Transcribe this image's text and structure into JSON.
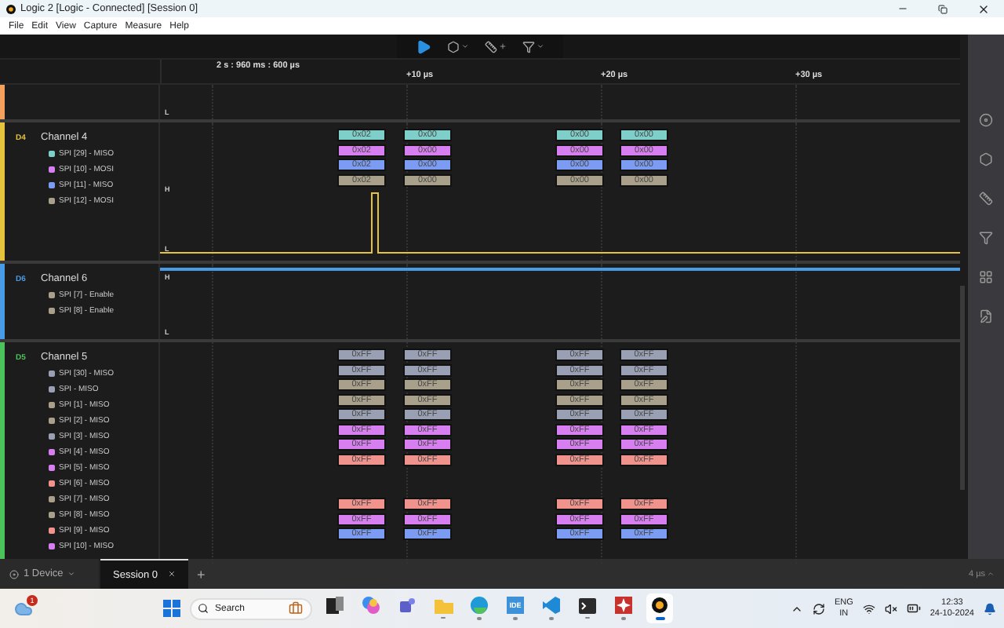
{
  "window": {
    "title": "Logic 2 [Logic - Connected] [Session 0]"
  },
  "menu": [
    "File",
    "Edit",
    "View",
    "Capture",
    "Measure",
    "Help"
  ],
  "timeline": {
    "origin": "2 s : 960 ms : 600 µs",
    "ticks": [
      "+10 µs",
      "+20 µs",
      "+30 µs"
    ]
  },
  "channels": [
    {
      "kind": "partial",
      "color": "#f4a15d",
      "markers": [
        {
          "text": "L",
          "kind": "low"
        }
      ]
    },
    {
      "kind": "digital",
      "id": "D4",
      "name": "Channel 4",
      "color": "#e5c33c",
      "trace": {
        "kind": "pulse"
      },
      "markers": [
        {
          "text": "H",
          "kind": "high"
        },
        {
          "text": "L",
          "kind": "low"
        }
      ],
      "analyzers": [
        {
          "label": "SPI [29] - MISO",
          "color": "#7ecfc9"
        },
        {
          "label": "SPI [10] - MOSI",
          "color": "#d77ff0"
        },
        {
          "label": "SPI [11] - MISO",
          "color": "#7b9cf2"
        },
        {
          "label": "SPI [12] - MOSI",
          "color": "#a8a08a"
        }
      ],
      "frames": [
        {
          "kind": "data",
          "color": "#7ecfc9",
          "values": [
            "0x02",
            "0x00",
            "0x00",
            "0x00"
          ]
        },
        {
          "kind": "data",
          "color": "#d77ff0",
          "values": [
            "0x02",
            "0x00",
            "0x00",
            "0x00"
          ]
        },
        {
          "kind": "data",
          "color": "#7b9cf2",
          "values": [
            "0x02",
            "0x00",
            "0x00",
            "0x00"
          ]
        },
        {
          "kind": "data",
          "color": "#a8a08a",
          "values": [
            "0x02",
            "0x00",
            "0x00",
            "0x00"
          ]
        }
      ]
    },
    {
      "kind": "digital",
      "id": "D6",
      "name": "Channel 6",
      "color": "#4a9be6",
      "trace": {
        "kind": "high"
      },
      "markers": [
        {
          "text": "H",
          "kind": "high"
        },
        {
          "text": "L",
          "kind": "low"
        }
      ],
      "analyzers": [
        {
          "label": "SPI [7] - Enable",
          "color": "#a8a08a"
        },
        {
          "label": "SPI [8] - Enable",
          "color": "#a8a08a"
        }
      ]
    },
    {
      "kind": "digital",
      "id": "D5",
      "name": "Channel 5",
      "color": "#4cc35a",
      "analyzers": [
        {
          "label": "SPI [30] - MISO",
          "color": "#9aa0b4"
        },
        {
          "label": "SPI - MISO",
          "color": "#9aa0b4"
        },
        {
          "label": "SPI [1] - MISO",
          "color": "#a8a08a"
        },
        {
          "label": "SPI [2] - MISO",
          "color": "#a8a08a"
        },
        {
          "label": "SPI [3] - MISO",
          "color": "#9aa0b4"
        },
        {
          "label": "SPI [4] - MISO",
          "color": "#d77ff0"
        },
        {
          "label": "SPI [5] - MISO",
          "color": "#d77ff0"
        },
        {
          "label": "SPI [6] - MISO",
          "color": "#f0938c"
        },
        {
          "label": "SPI [7] - MISO",
          "color": "#a8a08a"
        },
        {
          "label": "SPI [8] - MISO",
          "color": "#a8a08a"
        },
        {
          "label": "SPI [9] - MISO",
          "color": "#f0938c"
        },
        {
          "label": "SPI [10] - MISO",
          "color": "#d77ff0"
        }
      ],
      "frames": [
        {
          "kind": "data",
          "color": "#9aa0b4",
          "values": [
            "0xFF",
            "0xFF",
            "0xFF",
            "0xFF"
          ]
        },
        {
          "kind": "data",
          "color": "#9aa0b4",
          "values": [
            "0xFF",
            "0xFF",
            "0xFF",
            "0xFF"
          ]
        },
        {
          "kind": "data",
          "color": "#a8a08a",
          "values": [
            "0xFF",
            "0xFF",
            "0xFF",
            "0xFF"
          ]
        },
        {
          "kind": "data",
          "color": "#a8a08a",
          "values": [
            "0xFF",
            "0xFF",
            "0xFF",
            "0xFF"
          ]
        },
        {
          "kind": "data",
          "color": "#9aa0b4",
          "values": [
            "0xFF",
            "0xFF",
            "0xFF",
            "0xFF"
          ]
        },
        {
          "kind": "data",
          "color": "#d77ff0",
          "values": [
            "0xFF",
            "0xFF",
            "0xFF",
            "0xFF"
          ]
        },
        {
          "kind": "data",
          "color": "#d77ff0",
          "values": [
            "0xFF",
            "0xFF",
            "0xFF",
            "0xFF"
          ]
        },
        {
          "kind": "data",
          "color": "#f0938c",
          "values": [
            "0xFF",
            "0xFF",
            "0xFF",
            "0xFF"
          ]
        },
        {
          "kind": "gap"
        },
        {
          "kind": "gap"
        },
        {
          "kind": "data",
          "color": "#f0938c",
          "values": [
            "0xFF",
            "0xFF",
            "0xFF",
            "0xFF"
          ]
        },
        {
          "kind": "data",
          "color": "#d77ff0",
          "values": [
            "0xFF",
            "0xFF",
            "0xFF",
            "0xFF"
          ]
        },
        {
          "kind": "data",
          "color": "#7b9cf2",
          "values": [
            "0xFF",
            "0xFF",
            "0xFF",
            "0xFF"
          ]
        }
      ]
    }
  ],
  "tabbar": {
    "device": "1 Device",
    "tabs": [
      {
        "label": "Session 0",
        "selected": true
      }
    ],
    "add": "+",
    "zoom": "4 µs"
  },
  "taskbar": {
    "badge": "1",
    "search_placeholder": "Search",
    "apps": [
      {
        "kind": "taskview",
        "running": false,
        "selected": false
      },
      {
        "kind": "copilot",
        "running": false,
        "selected": false
      },
      {
        "kind": "teams",
        "running": false,
        "selected": false
      },
      {
        "kind": "folder",
        "running": true,
        "selected": false
      },
      {
        "kind": "edge",
        "running": true,
        "selected": false
      },
      {
        "kind": "ide",
        "label": "IDE",
        "running": true,
        "selected": false
      },
      {
        "kind": "vscode",
        "running": true,
        "selected": false
      },
      {
        "kind": "terminal",
        "running": true,
        "selected": false
      },
      {
        "kind": "redapp",
        "running": true,
        "selected": false
      },
      {
        "kind": "logic",
        "running": true,
        "selected": true
      }
    ],
    "language": "ENG",
    "region": "IN",
    "time": "12:33",
    "date": "24-10-2024"
  }
}
